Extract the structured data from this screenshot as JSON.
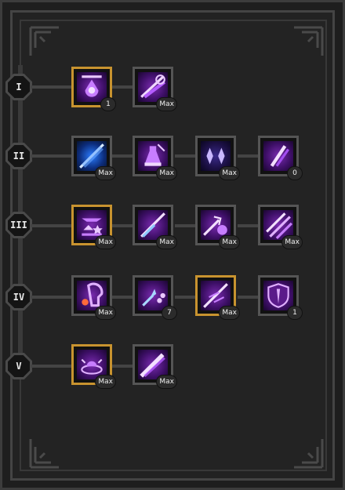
{
  "tiers": [
    {
      "label": "I"
    },
    {
      "label": "II"
    },
    {
      "label": "III"
    },
    {
      "label": "IV"
    },
    {
      "label": "V"
    }
  ],
  "skills": {
    "t1": [
      {
        "level": "1",
        "icon": "mana-potion-icon"
      },
      {
        "level": "Max",
        "icon": "arcane-slash-icon"
      }
    ],
    "t2": [
      {
        "level": "Max",
        "icon": "lightning-spear-icon"
      },
      {
        "level": "Max",
        "icon": "arcane-flask-icon"
      },
      {
        "level": "Max",
        "icon": "twin-crystals-icon"
      },
      {
        "level": "0",
        "icon": "rift-slash-icon"
      }
    ],
    "t3": [
      {
        "level": "Max",
        "icon": "arcane-altar-icon"
      },
      {
        "level": "Max",
        "icon": "piercing-beam-icon"
      },
      {
        "level": "Max",
        "icon": "spear-orb-icon"
      },
      {
        "level": "Max",
        "icon": "triple-slash-icon"
      }
    ],
    "t4": [
      {
        "level": "Max",
        "icon": "arcane-mind-icon"
      },
      {
        "level": "7",
        "icon": "shard-burst-icon"
      },
      {
        "level": "Max",
        "icon": "chain-lance-icon"
      },
      {
        "level": "1",
        "icon": "arcane-shield-icon"
      }
    ],
    "t5": [
      {
        "level": "Max",
        "icon": "summoning-circle-icon"
      },
      {
        "level": "Max",
        "icon": "comet-strike-icon"
      }
    ]
  },
  "colors": {
    "gold_frame": "#c8932f",
    "icon_purple": "#7a2bb0",
    "frame_gray": "#555555"
  }
}
